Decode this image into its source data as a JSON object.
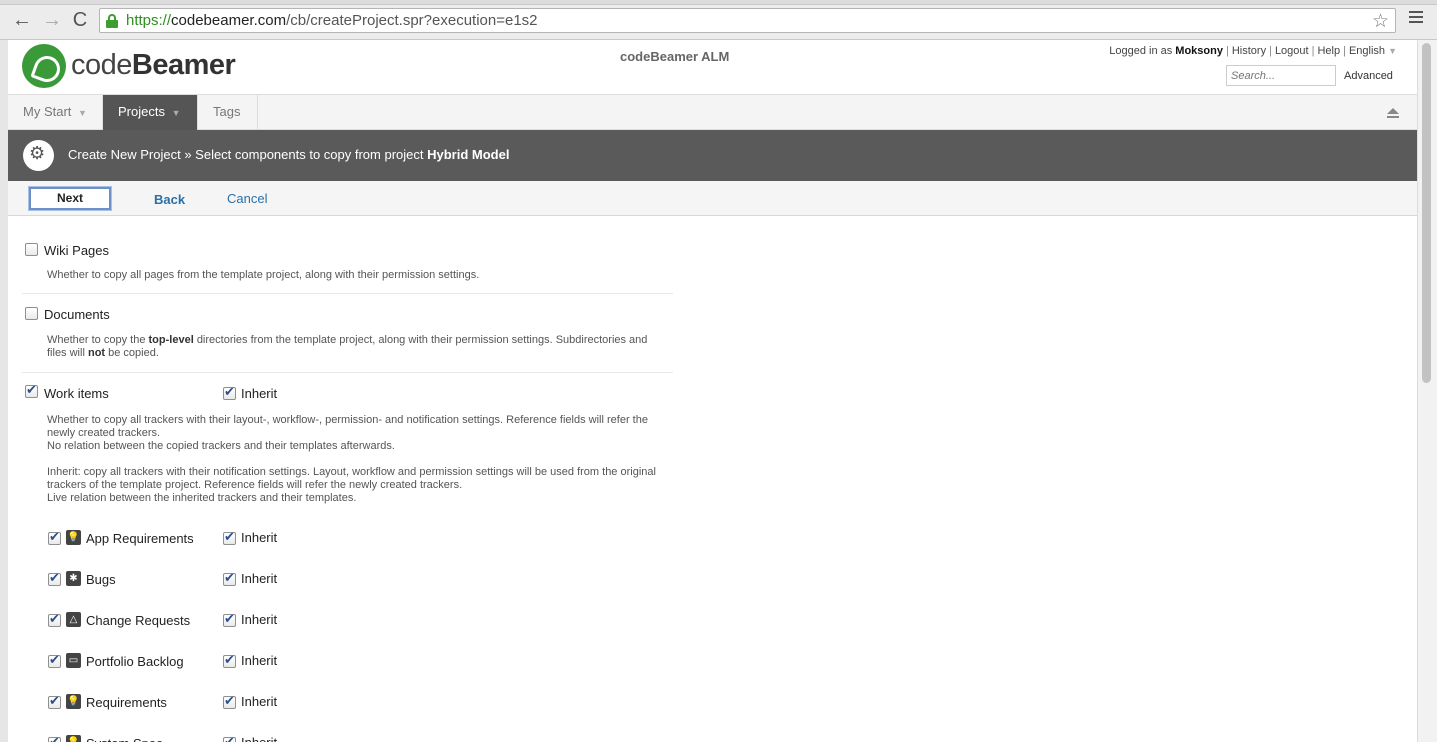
{
  "browser": {
    "url_scheme": "https://",
    "url_host": "codebeamer.com",
    "url_path": "/cb/createProject.spr?execution=e1s2",
    "nav_back": "←",
    "nav_forward": "→",
    "nav_reload": "C",
    "star": "☆"
  },
  "header": {
    "brand_light": "code",
    "brand_bold": "Beamer",
    "app_name": "codeBeamer ALM",
    "logged_in_as": "Logged in as",
    "user": "Moksony",
    "history": "History",
    "logout": "Logout",
    "help": "Help",
    "language": "English",
    "caret": "▼",
    "search_placeholder": "Search...",
    "advanced": "Advanced"
  },
  "nav": {
    "my_start": "My Start",
    "projects": "Projects",
    "tags": "Tags",
    "caret": "▼"
  },
  "title": {
    "prefix": "Create New Project » Select components to copy from project",
    "project": "Hybrid Model"
  },
  "actions": {
    "next": "Next",
    "back": "Back",
    "cancel": "Cancel"
  },
  "sections": {
    "wiki": {
      "label": "Wiki Pages",
      "checked": false,
      "desc": "Whether to copy all pages from the template project, along with their permission settings."
    },
    "documents": {
      "label": "Documents",
      "checked": false,
      "desc_1": "Whether to copy the",
      "desc_bold_1": "top-level",
      "desc_2": "directories from the template project, along with their permission settings. Subdirectories and files will",
      "desc_bold_2": "not",
      "desc_3": "be copied."
    },
    "work_items": {
      "label": "Work items",
      "checked": true,
      "inherit_label": "Inherit",
      "inherit_checked": true,
      "desc_line1": "Whether to copy all trackers with their layout-, workflow-, permission- and notification settings. Reference fields will refer the newly created trackers.",
      "desc_line2": "No relation between the copied trackers and their templates afterwards.",
      "desc_line3": "Inherit: copy all trackers with their notification settings. Layout, workflow and permission settings will be used from the original trackers of the template project. Reference fields will refer the newly created trackers.",
      "desc_line4": "Live relation between the inherited trackers and their templates."
    }
  },
  "trackers": [
    {
      "label": "App Requirements",
      "icon": "💡",
      "icon_name": "requirement-icon",
      "inherit": "Inherit"
    },
    {
      "label": "Bugs",
      "icon": "✱",
      "icon_name": "bug-icon",
      "inherit": "Inherit"
    },
    {
      "label": "Change Requests",
      "icon": "△",
      "icon_name": "change-request-icon",
      "inherit": "Inherit"
    },
    {
      "label": "Portfolio Backlog",
      "icon": "▭",
      "icon_name": "backlog-icon",
      "inherit": "Inherit"
    },
    {
      "label": "Requirements",
      "icon": "💡",
      "icon_name": "requirement-icon",
      "inherit": "Inherit"
    },
    {
      "label": "System Spec",
      "icon": "💡",
      "icon_name": "requirement-icon",
      "inherit": "Inherit"
    }
  ]
}
